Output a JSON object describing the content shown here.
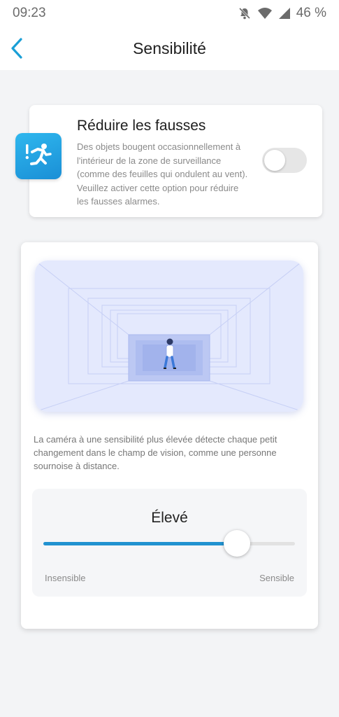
{
  "status_bar": {
    "time": "09:23",
    "battery": "46 %",
    "icons": [
      "bell-muted-icon",
      "wifi-icon",
      "cell-signal-icon"
    ]
  },
  "app_bar": {
    "title": "Sensibilité",
    "back_icon": "chevron-left-icon"
  },
  "false_alarm_card": {
    "title": "Réduire les fausses",
    "description": "Des objets bougent occasionnellement à l'intérieur de la zone de surveillance (comme des feuilles qui ondulent au vent). Veuillez activer cette option pour réduire les fausses alarmes.",
    "icon": "running-person-alert-icon",
    "toggle_on": false
  },
  "sensitivity_card": {
    "illustration": "person-in-corridor-illustration",
    "info": "La caméra à une sensibilité plus élevée détecte chaque petit changement dans le champ de vision, comme une personne sournoise à distance.",
    "level_label": "Élevé",
    "slider_value": 0.77,
    "min_label": "Insensible",
    "max_label": "Sensible"
  },
  "colors": {
    "accent": "#2192d0",
    "icon_gradient_start": "#2fb7ee",
    "icon_gradient_end": "#1a8fd6",
    "back_arrow": "#1a9fd6",
    "scene_bg": "#e4e9fd"
  }
}
